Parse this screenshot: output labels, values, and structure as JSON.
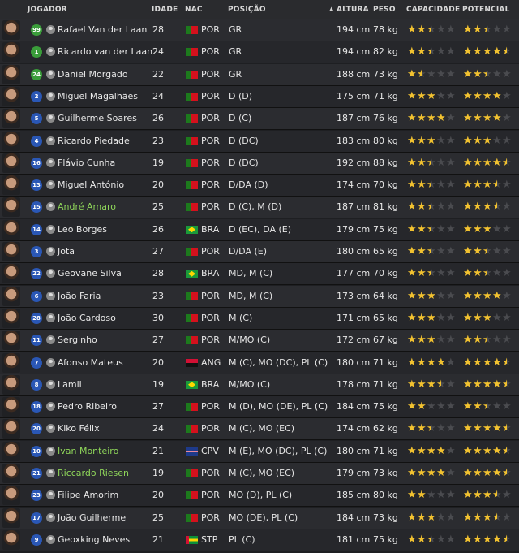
{
  "columns": {
    "jogador": "JOGADOR",
    "idade": "IDADE",
    "nac": "NAC",
    "posicao": "POSIÇÃO",
    "altura": "ALTURA",
    "peso": "PESO",
    "capacidade": "CAPACIDADE",
    "potencial": "POTENCIAL"
  },
  "sort": {
    "column": "altura",
    "direction": "ascending",
    "icon": "sort-up-triangle"
  },
  "colors": {
    "star": "#f2c230",
    "star_empty": "#4a4b4f",
    "loan_name": "#8fd65a",
    "gk_number": "#3a9d3a",
    "outfield_number": "#2a57b5"
  },
  "players": [
    {
      "number": "99",
      "name": "Rafael Van der Laan",
      "age": "28",
      "nat": "POR",
      "pos": "GR",
      "height": "194 cm",
      "weight": "78 kg",
      "ca": 2.5,
      "pa": 2.5,
      "gk": true,
      "loan": false
    },
    {
      "number": "1",
      "name": "Ricardo van der Laan",
      "age": "24",
      "nat": "POR",
      "pos": "GR",
      "height": "194 cm",
      "weight": "82 kg",
      "ca": 2.5,
      "pa": 4.5,
      "gk": true,
      "loan": false
    },
    {
      "number": "24",
      "name": "Daniel Morgado",
      "age": "22",
      "nat": "POR",
      "pos": "GR",
      "height": "188 cm",
      "weight": "73 kg",
      "ca": 1.5,
      "pa": 2.5,
      "gk": true,
      "loan": false
    },
    {
      "number": "2",
      "name": "Miguel Magalhães",
      "age": "24",
      "nat": "POR",
      "pos": "D (D)",
      "height": "175 cm",
      "weight": "71 kg",
      "ca": 3,
      "pa": 4,
      "gk": false,
      "loan": false
    },
    {
      "number": "5",
      "name": "Guilherme Soares",
      "age": "26",
      "nat": "POR",
      "pos": "D (C)",
      "height": "187 cm",
      "weight": "76 kg",
      "ca": 4,
      "pa": 4,
      "gk": false,
      "loan": false
    },
    {
      "number": "4",
      "name": "Ricardo Piedade",
      "age": "23",
      "nat": "POR",
      "pos": "D (DC)",
      "height": "183 cm",
      "weight": "80 kg",
      "ca": 3,
      "pa": 3,
      "gk": false,
      "loan": false
    },
    {
      "number": "16",
      "name": "Flávio Cunha",
      "age": "19",
      "nat": "POR",
      "pos": "D (DC)",
      "height": "192 cm",
      "weight": "88 kg",
      "ca": 2.5,
      "pa": 4.5,
      "gk": false,
      "loan": false
    },
    {
      "number": "13",
      "name": "Miguel António",
      "age": "20",
      "nat": "POR",
      "pos": "D/DA (D)",
      "height": "174 cm",
      "weight": "70 kg",
      "ca": 2.5,
      "pa": 3.5,
      "gk": false,
      "loan": false
    },
    {
      "number": "15",
      "name": "André Amaro",
      "age": "25",
      "nat": "POR",
      "pos": "D (C), M (D)",
      "height": "187 cm",
      "weight": "81 kg",
      "ca": 2.5,
      "pa": 3.5,
      "gk": false,
      "loan": true
    },
    {
      "number": "14",
      "name": "Leo Borges",
      "age": "26",
      "nat": "BRA",
      "pos": "D (EC), DA (E)",
      "height": "179 cm",
      "weight": "75 kg",
      "ca": 2.5,
      "pa": 3,
      "gk": false,
      "loan": false
    },
    {
      "number": "3",
      "name": "Jota",
      "age": "27",
      "nat": "POR",
      "pos": "D/DA (E)",
      "height": "180 cm",
      "weight": "65 kg",
      "ca": 2.5,
      "pa": 2.5,
      "gk": false,
      "loan": false
    },
    {
      "number": "22",
      "name": "Geovane Silva",
      "age": "28",
      "nat": "BRA",
      "pos": "MD, M (C)",
      "height": "177 cm",
      "weight": "70 kg",
      "ca": 2.5,
      "pa": 2.5,
      "gk": false,
      "loan": false
    },
    {
      "number": "6",
      "name": "João Faria",
      "age": "23",
      "nat": "POR",
      "pos": "MD, M (C)",
      "height": "173 cm",
      "weight": "64 kg",
      "ca": 3,
      "pa": 4,
      "gk": false,
      "loan": false
    },
    {
      "number": "28",
      "name": "João Cardoso",
      "age": "30",
      "nat": "POR",
      "pos": "M (C)",
      "height": "171 cm",
      "weight": "65 kg",
      "ca": 3,
      "pa": 3,
      "gk": false,
      "loan": false
    },
    {
      "number": "11",
      "name": "Serginho",
      "age": "27",
      "nat": "POR",
      "pos": "M/MO (C)",
      "height": "172 cm",
      "weight": "67 kg",
      "ca": 3,
      "pa": 2.5,
      "gk": false,
      "loan": false
    },
    {
      "number": "7",
      "name": "Afonso Mateus",
      "age": "20",
      "nat": "ANG",
      "pos": "M (C), MO (DC), PL (C)",
      "height": "180 cm",
      "weight": "71 kg",
      "ca": 4,
      "pa": 4.5,
      "gk": false,
      "loan": false
    },
    {
      "number": "8",
      "name": "Lamil",
      "age": "19",
      "nat": "BRA",
      "pos": "M/MO (C)",
      "height": "178 cm",
      "weight": "71 kg",
      "ca": 3.5,
      "pa": 4.5,
      "gk": false,
      "loan": false
    },
    {
      "number": "18",
      "name": "Pedro Ribeiro",
      "age": "27",
      "nat": "POR",
      "pos": "M (D), MO (DE), PL (C)",
      "height": "184 cm",
      "weight": "75 kg",
      "ca": 2,
      "pa": 2.5,
      "gk": false,
      "loan": false
    },
    {
      "number": "20",
      "name": "Kiko Félix",
      "age": "24",
      "nat": "POR",
      "pos": "M (C), MO (EC)",
      "height": "174 cm",
      "weight": "62 kg",
      "ca": 2.5,
      "pa": 4.5,
      "gk": false,
      "loan": false
    },
    {
      "number": "10",
      "name": "Ivan Monteiro",
      "age": "21",
      "nat": "CPV",
      "pos": "M (E), MO (DC), PL (C)",
      "height": "180 cm",
      "weight": "71 kg",
      "ca": 4,
      "pa": 4.5,
      "gk": false,
      "loan": true
    },
    {
      "number": "21",
      "name": "Riccardo Riesen",
      "age": "19",
      "nat": "POR",
      "pos": "M (C), MO (EC)",
      "height": "179 cm",
      "weight": "73 kg",
      "ca": 4,
      "pa": 4.5,
      "gk": false,
      "loan": true
    },
    {
      "number": "23",
      "name": "Filipe Amorim",
      "age": "20",
      "nat": "POR",
      "pos": "MO (D), PL (C)",
      "height": "185 cm",
      "weight": "80 kg",
      "ca": 2,
      "pa": 3.5,
      "gk": false,
      "loan": false
    },
    {
      "number": "17",
      "name": "João Guilherme",
      "age": "25",
      "nat": "POR",
      "pos": "MO (DE), PL (C)",
      "height": "184 cm",
      "weight": "73 kg",
      "ca": 3,
      "pa": 3.5,
      "gk": false,
      "loan": false
    },
    {
      "number": "9",
      "name": "Geoxking Neves",
      "age": "21",
      "nat": "STP",
      "pos": "PL (C)",
      "height": "181 cm",
      "weight": "75 kg",
      "ca": 2.5,
      "pa": 4.5,
      "gk": false,
      "loan": false
    }
  ]
}
